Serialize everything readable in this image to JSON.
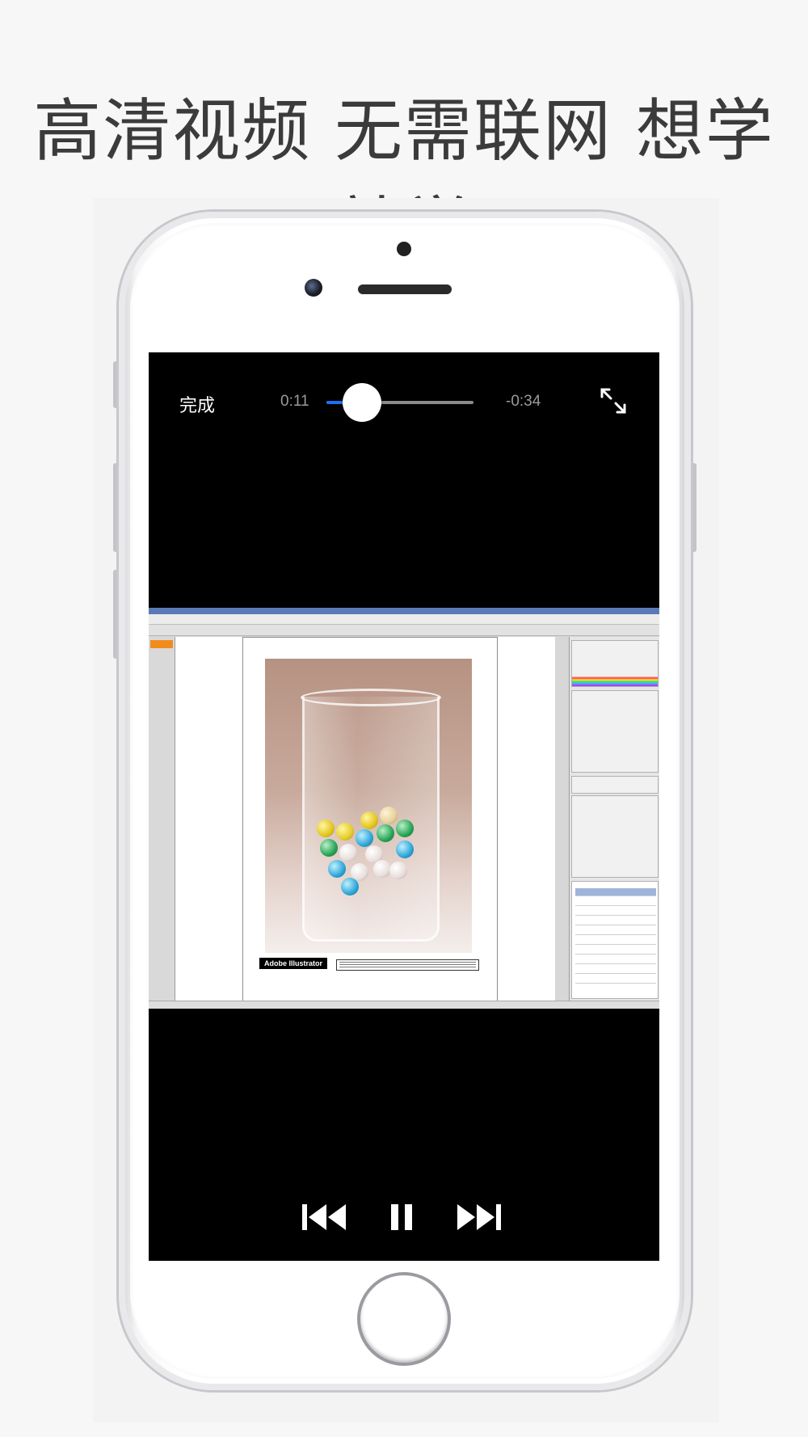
{
  "headline": "高清视频 无需联网 想学就学",
  "player": {
    "done_label": "完成",
    "time_elapsed": "0:11",
    "time_remaining": "-0:34",
    "progress": 0.244,
    "accent_color": "#1e6ef0"
  },
  "icons": {
    "fullscreen": "expand-arrows-icon",
    "previous": "skip-back-icon",
    "pause": "pause-icon",
    "next": "skip-forward-icon"
  },
  "video_frame": {
    "caption_logo": "Adobe Illustrator"
  }
}
